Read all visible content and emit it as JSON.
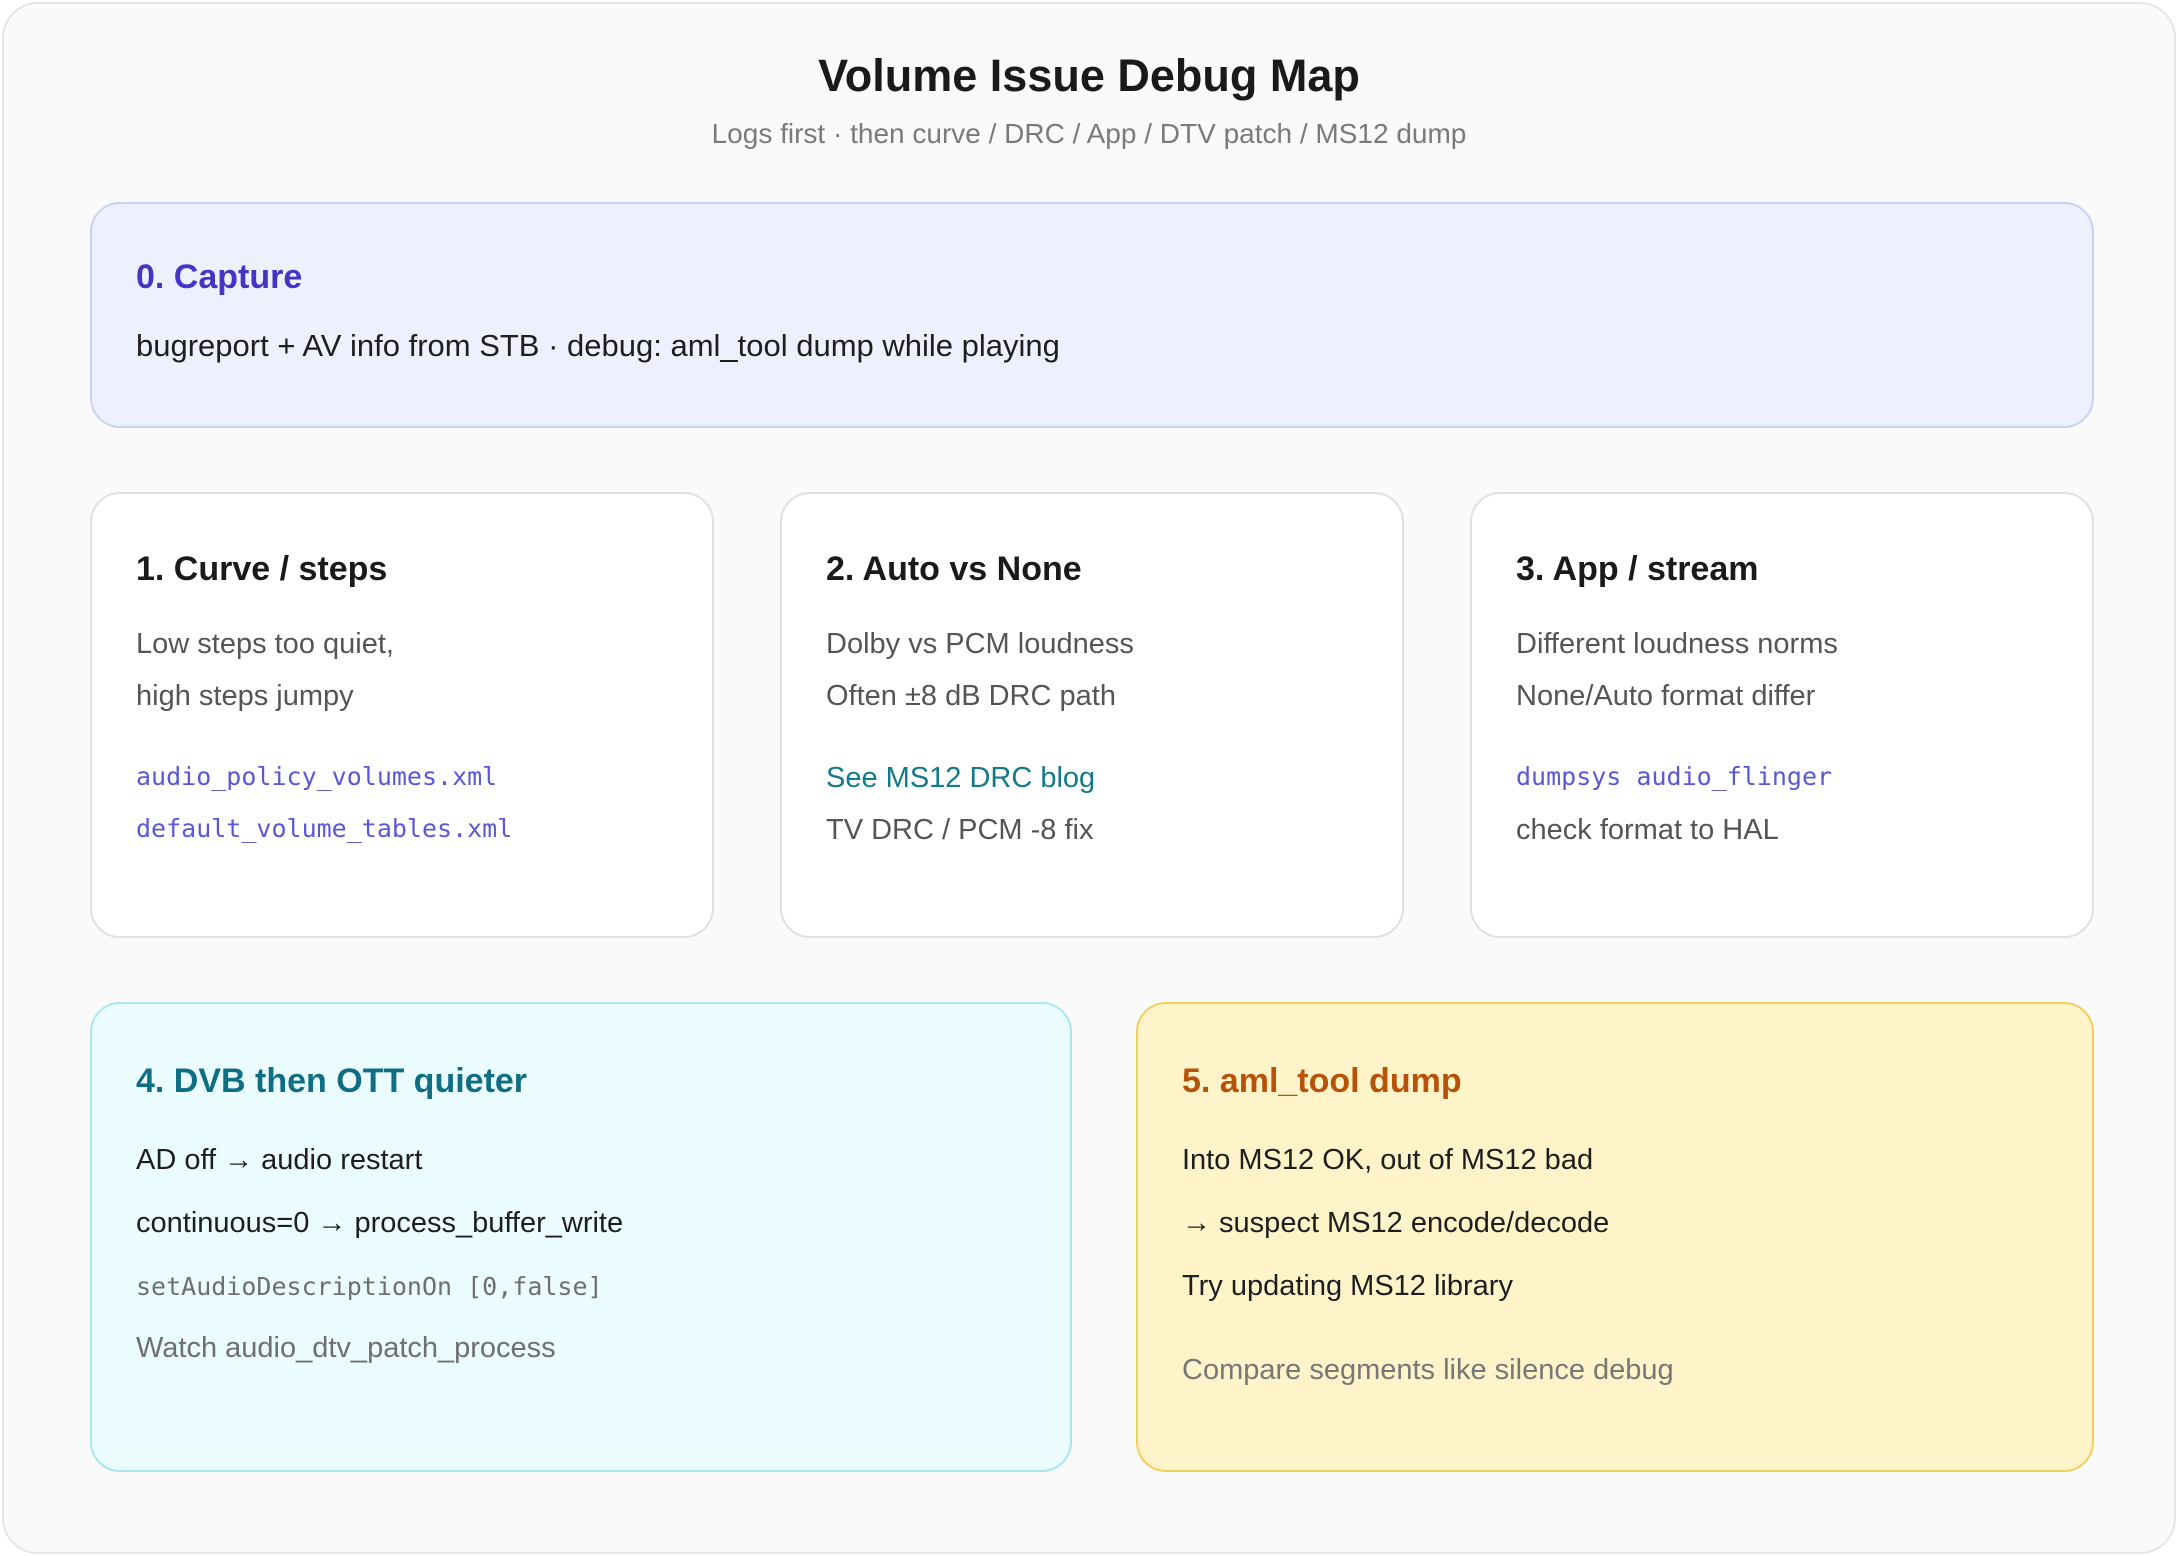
{
  "header": {
    "title": "Volume Issue Debug Map",
    "subtitle": "Logs first · then curve / DRC / App / DTV patch / MS12 dump"
  },
  "capture": {
    "title": "0. Capture",
    "text": "bugreport + AV info from STB · debug: aml_tool dump while playing"
  },
  "curve": {
    "title": "1. Curve / steps",
    "line1": "Low steps too quiet,",
    "line2": "high steps jumpy",
    "file1": "audio_policy_volumes.xml",
    "file2": "default_volume_tables.xml"
  },
  "auto_none": {
    "title": "2. Auto vs None",
    "line1": "Dolby vs PCM loudness",
    "line2": "Often ±8 dB DRC path",
    "link": "See MS12 DRC blog",
    "line4": "TV DRC / PCM -8 fix"
  },
  "app_stream": {
    "title": "3. App / stream",
    "line1": "Different loudness norms",
    "line2": "None/Auto format differ",
    "command": "dumpsys audio_flinger",
    "line4": "check format to HAL"
  },
  "dvb": {
    "title": "4. DVB then OTT quieter",
    "line1": "AD off → audio restart",
    "line2": "continuous=0 → process_buffer_write",
    "code": "setAudioDescriptionOn [0,false]",
    "line4": "Watch audio_dtv_patch_process"
  },
  "dump": {
    "title": "5. aml_tool dump",
    "line1": "Into MS12 OK, out of MS12 bad",
    "line2": "→ suspect MS12 encode/decode",
    "line3": "Try updating MS12 library",
    "line4": "Compare segments like silence debug"
  },
  "colors": {
    "capture_bg": "#eef0fd",
    "capture_title": "#4535c4",
    "dvb_bg": "#ebfcfe",
    "dvb_title": "#0f6e84",
    "dump_bg": "#fef3c9",
    "dump_title": "#b65309",
    "code_blue": "#5a58d6",
    "link_teal": "#137a8a"
  }
}
